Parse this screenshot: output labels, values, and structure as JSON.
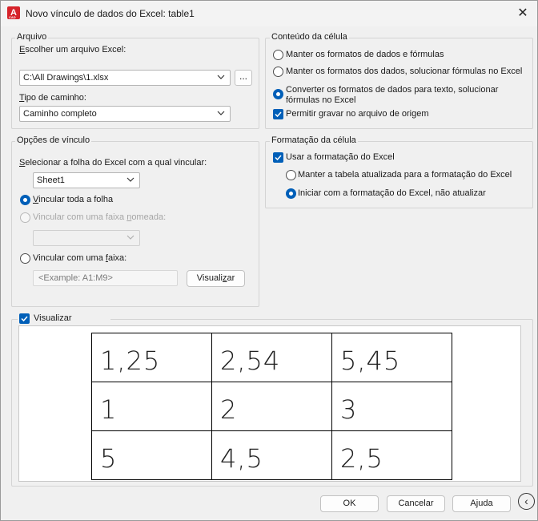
{
  "window": {
    "title": "Novo vínculo de dados do Excel: table1",
    "app_icon_letter": "A",
    "app_icon_sub": "CAD",
    "close_glyph": "✕"
  },
  "arquivo": {
    "title": "Arquivo",
    "file_label_prefix": "E",
    "file_label_rest": "scolher um arquivo Excel:",
    "file_value": "C:\\All Drawings\\1.xlsx",
    "browse_label": "...",
    "path_label_prefix": "T",
    "path_label_rest": "ipo de caminho:",
    "path_value": "Caminho completo"
  },
  "conteudo": {
    "title": "Conteúdo da célula",
    "options": [
      {
        "label": "Manter os formatos de dados e fórmulas",
        "checked": false
      },
      {
        "label": "Manter os formatos dos dados, solucionar fórmulas no Excel",
        "checked": false
      },
      {
        "label_line1": "Converter os formatos de dados para texto, solucionar",
        "label_line2": "fórmulas no Excel",
        "checked": true
      }
    ],
    "allow_write_back": "Permitir gravar no arquivo de origem"
  },
  "opcoes": {
    "title": "Opções de vínculo",
    "sheet_label_prefix": "S",
    "sheet_label_rest": "elecionar a folha do Excel com a qual vincular:",
    "sheet_value": "Sheet1",
    "link_entire_prefix": "V",
    "link_entire_rest": "incular toda a folha",
    "link_named_pre": "Vincular com uma faixa ",
    "link_named_u": "n",
    "link_named_post": "omeada:",
    "link_range_pre": "Vincular com uma ",
    "link_range_u": "f",
    "link_range_post": "aixa:",
    "range_placeholder": "<Example: A1:M9>",
    "preview_button_pre": "Visuali",
    "preview_button_u": "z",
    "preview_button_post": "ar"
  },
  "formatacao": {
    "title": "Formatação da célula",
    "use_excel_format": "Usar a formatação do Excel",
    "keep_updated": "Manter a tabela atualizada para a formatação do Excel",
    "start_with": "Iniciar com a formatação do Excel, não atualizar"
  },
  "preview": {
    "label": "Visualizar",
    "checked": true,
    "rows": [
      [
        "1,25",
        "2,54",
        "5,45"
      ],
      [
        "1",
        "2",
        "3"
      ],
      [
        "5",
        "4,5",
        "2,5"
      ]
    ]
  },
  "footer": {
    "ok": "OK",
    "cancel": "Cancelar",
    "help": "Ajuda",
    "back_glyph": "‹"
  },
  "colors": {
    "accent": "#005fb8",
    "app_icon": "#d6232a"
  }
}
